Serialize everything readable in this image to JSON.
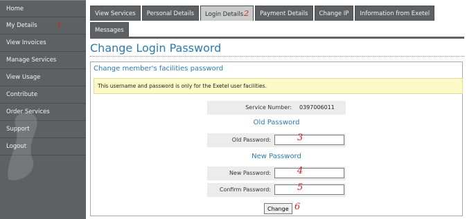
{
  "sidebar": {
    "items": [
      {
        "label": "Home",
        "marker": ""
      },
      {
        "label": "My Details",
        "marker": "1"
      },
      {
        "label": "View Invoices",
        "marker": ""
      },
      {
        "label": "Manage Services",
        "marker": ""
      },
      {
        "label": "View Usage",
        "marker": ""
      },
      {
        "label": "Contribute",
        "marker": ""
      },
      {
        "label": "Order Services",
        "marker": ""
      },
      {
        "label": "Support",
        "marker": ""
      },
      {
        "label": "Logout",
        "marker": ""
      }
    ]
  },
  "tabs": {
    "row1": [
      {
        "label": "View Services",
        "active": false,
        "marker": ""
      },
      {
        "label": "Personal Details",
        "active": false,
        "marker": ""
      },
      {
        "label": "Login Details",
        "active": true,
        "marker": "2"
      },
      {
        "label": "Payment Details",
        "active": false,
        "marker": ""
      },
      {
        "label": "Change IP",
        "active": false,
        "marker": ""
      },
      {
        "label": "Information from Exetel",
        "active": false,
        "marker": ""
      }
    ],
    "row2": [
      {
        "label": "Messages",
        "active": false,
        "marker": ""
      }
    ]
  },
  "page": {
    "title": "Change Login Password",
    "panel_heading": "Change member's facilities password",
    "notice": "This username and password is only for the Exetel user facilities."
  },
  "form": {
    "service_number_label": "Service Number:",
    "service_number_value": "0397006011",
    "old_password_section": "Old Password",
    "old_password_label": "Old Password:",
    "old_password_marker": "3",
    "old_password_value": "",
    "new_password_section": "New Password",
    "new_password_label": "New Password:",
    "new_password_marker": "4",
    "new_password_value": "",
    "confirm_password_label": "Confirm Password:",
    "confirm_password_marker": "5",
    "confirm_password_value": "",
    "change_label": "Change",
    "change_marker": "6"
  },
  "colors": {
    "sidebar_bg": "#5e6164",
    "accent_blue": "#2b7bb0",
    "notice_bg": "#fdfac8",
    "annotation_red": "#d42020"
  }
}
